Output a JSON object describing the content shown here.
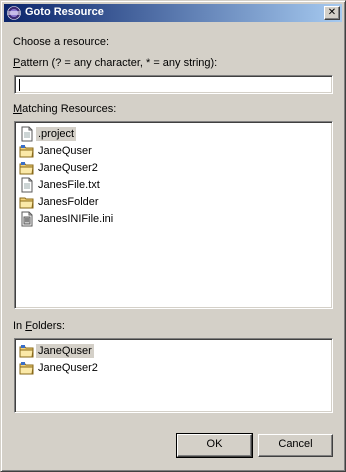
{
  "window": {
    "title": "Goto Resource"
  },
  "labels": {
    "choose": "Choose a resource:",
    "pattern_accel": "P",
    "pattern_rest": "attern (? = any character, * = any string):",
    "matching_accel": "M",
    "matching_rest": "atching Resources:",
    "folders_pre": "In ",
    "folders_accel": "F",
    "folders_rest": "olders:"
  },
  "pattern_input": {
    "value": ""
  },
  "matching_resources": [
    {
      "name": ".project",
      "icon": "file-icon",
      "selected": true
    },
    {
      "name": "JaneQuser",
      "icon": "project-folder-icon",
      "selected": false
    },
    {
      "name": "JaneQuser2",
      "icon": "project-folder-icon",
      "selected": false
    },
    {
      "name": "JanesFile.txt",
      "icon": "file-icon",
      "selected": false
    },
    {
      "name": "JanesFolder",
      "icon": "folder-icon",
      "selected": false
    },
    {
      "name": "JanesINIFile.ini",
      "icon": "ini-file-icon",
      "selected": false
    }
  ],
  "in_folders": [
    {
      "name": "JaneQuser",
      "icon": "project-folder-icon",
      "selected": true
    },
    {
      "name": "JaneQuser2",
      "icon": "project-folder-icon",
      "selected": false
    }
  ],
  "buttons": {
    "ok": "OK",
    "cancel": "Cancel"
  },
  "colors": {
    "titlebar_start": "#0a246a",
    "titlebar_end": "#a6caf0",
    "dialog_bg": "#d4d0c8"
  }
}
